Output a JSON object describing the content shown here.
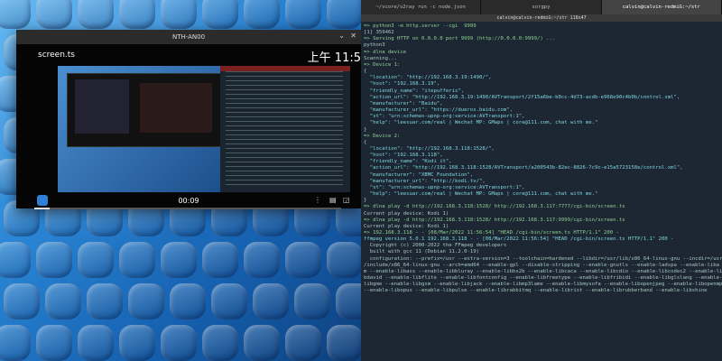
{
  "player": {
    "window_title": "NTH-AN00",
    "file_name": "screen.ts",
    "clock": "上午 11:5",
    "time": "00:09",
    "progress": 0.05,
    "icons": [
      "close-icon",
      "chevron-down-icon",
      "stop-icon",
      "menu-icon",
      "subtitles-icon",
      "aspect-icon",
      "exit-icon"
    ]
  },
  "terminal": {
    "tabs": [
      "~/vcore/v2ray run -c node.json",
      "sorgpy",
      "calvin@calvin-redmiG:~/str"
    ],
    "title": "calvin@calvin-redmiG:~/str 118x47",
    "lines": [
      "=> python3 -m http.server --cgi  9999",
      "[1] 359462",
      "=> Serving HTTP on 0.0.0.0 port 9999 (http://0.0.0.0:9999/) ...",
      "python3",
      "=> dlna device",
      "Scanning...",
      "=> Device 1:",
      "{",
      "  \"location\": \"http://192.168.3.19:1490/\",",
      "  \"host\": \"192.168.3.19\",",
      "  \"friendly_name\": \"itepufferis\",",
      "  \"action_url\": \"http://192.168.3.19:1490/AVTransport/2f15a6be-b0cc-4d73-acdb-e968e90c4b0b/control.xml\",",
      "  \"manufacturer\": \"Baidu\",",
      "  \"manufacturer_url\": \"https://dueros.baidu.com\",",
      "  \"st\": \"urn:schemas-upnp-org:service:AVTransport:1\",",
      "  \"help\": \"leesuar.com/real | Wechat MP: GMaps | core@111.com, chat with me.\"",
      "}",
      "",
      "=> Device 2:",
      "{",
      "  \"location\": \"http://192.168.3.118:1528/\",",
      "  \"host\": \"192.168.3.118\",",
      "  \"friendly_name\": \"Kodi it\",",
      "  \"action_url\": \"http://192.168.3.118:1528/AVTransport/a200543b-82ec-8826-7c9c-e15a5723158e/control.xml\",",
      "  \"manufacturer\": \"XBMC Foundation\",",
      "  \"manufacturer_url\": \"http://kodi.tv/\",",
      "  \"st\": \"urn:schemas-upnp-org:service:AVTransport:1\",",
      "  \"help\": \"leesuar.com/real | Wechat MP: GMaps | core@111.com, chat with me.\"",
      "}",
      "",
      "=> dlna play -d http://192.168.3.118:1528/ http://192.168.3.117:7777/cgi-bin/screen.ts",
      "Current play device: Kodi 1)",
      "=> dlna play -d http://192.168.3.118:1528/ http://192.168.3.117:9999/cgi-bin/screen.ts",
      "Current play device: Kodi 1)",
      "=> 192.168.3.118 - - [08/Mar/2022 11:56:54] \"HEAD /cgi-bin/screen.ts HTTP/1.1\" 200 -",
      "ffmpeg version 5.0.1 192.168.3.118 - - [08/Mar/2022 11:56:54] \"HEAD /cgi-bin/screen.ts HTTP/1.1\" 200 -",
      "  Copyright (c) 2000-2022 the FFmpeg developers",
      "  built with gcc 11 (Debian 11.2.0-19)",
      "  configuration: --prefix=/usr --extra-version=3 --toolchain=hardened --libdir=/usr/lib/x86_64-linux-gnu --incdir=/usr",
      "/include/x86_64-linux-gnu --arch=amd64 --enable-gpl --disable-stripping --enable-gnutls --enable-ladspa --enable-liba",
      "m --enable-libass --enable-libbluray --enable-libbs2b --enable-libcaca --enable-libcdio --enable-libcodec2 --enable-li",
      "bdavid --enable-libflite --enable-libfontconfig --enable-libfreetype --enable-libfribidi --enable-libglslang --enable-",
      "libgme --enable-libgsm --enable-libjack --enable-libmp3lame --enable-libmysofa --enable-libopenjpeg --enable-libopenmpt",
      "--enable-libopus --enable-libpulse --enable-librabbitmq --enable-librist --enable-librubberband --enable-libshine"
    ]
  }
}
